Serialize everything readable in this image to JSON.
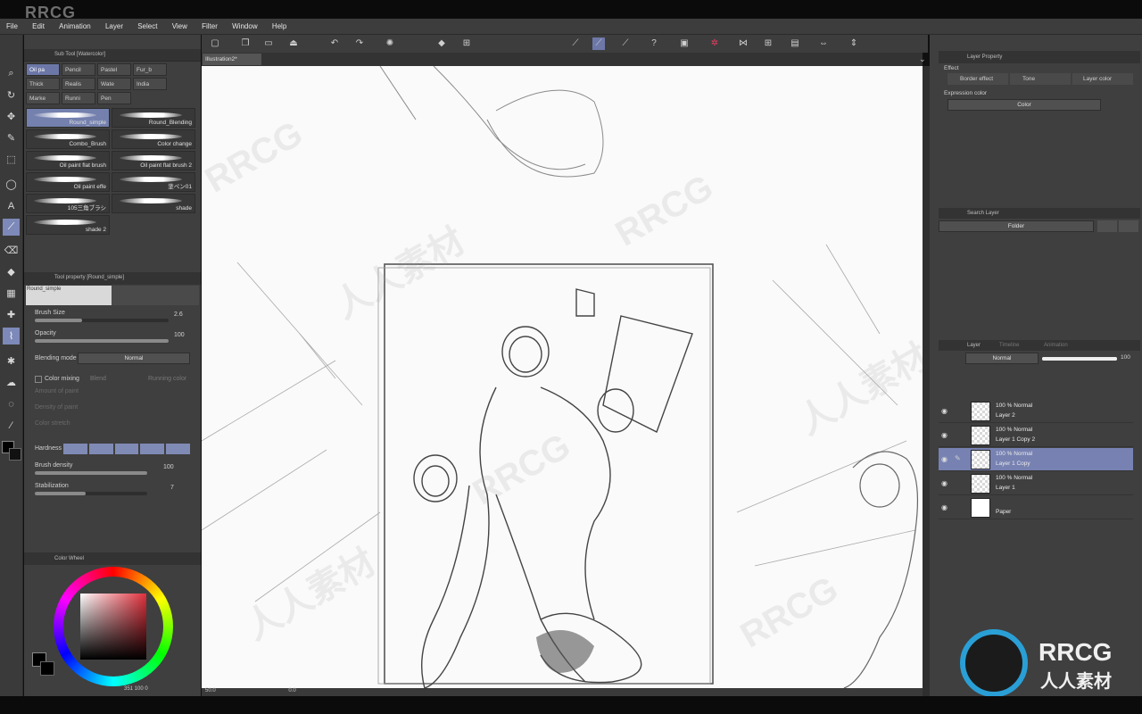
{
  "menu": [
    "File",
    "Edit",
    "Animation",
    "Layer",
    "Select",
    "View",
    "Filter",
    "Window",
    "Help"
  ],
  "watermark_logo": "RRCG",
  "watermark_text": "人人素材",
  "subtool": {
    "title": "Sub Tool [Watercolor]",
    "tabs": [
      "Oil pa",
      "Pencil",
      "Pastel",
      "Fur_b",
      "Thick",
      "Realis",
      "Wate",
      "India",
      "Marke",
      "Runni",
      "Pen"
    ],
    "brushes": [
      "Round_simple",
      "Round_Blending",
      "Combo_Brush",
      "Color change",
      "Oil paint flat brush",
      "Oil paint flat brush 2",
      "Oil paint effe",
      "塗ペン01",
      "105三角ブラシ",
      "shade",
      "shade 2"
    ]
  },
  "toolprop": {
    "title": "Tool property [Round_simple]",
    "preview_name": "Round_simple",
    "brush_size_label": "Brush Size",
    "brush_size": "2.6",
    "opacity_label": "Opacity",
    "opacity": "100",
    "blending_label": "Blending mode",
    "blending": "Normal",
    "color_mixing": "Color mixing",
    "blend": "Blend",
    "running_color": "Running color",
    "amount_of_paint": "Amount of paint",
    "density_of_paint": "Density of paint",
    "color_stretch": "Color stretch",
    "hardness_label": "Hardness",
    "brush_density_label": "Brush density",
    "brush_density": "100",
    "stabilization_label": "Stabilization",
    "stabilization": "7"
  },
  "colorwheel": {
    "title": "Color Wheel",
    "readout": "351 100 0"
  },
  "document": {
    "tab": "Illustration2*",
    "zoom": "50.0",
    "rotation": "0.0"
  },
  "layer_property": {
    "title": "Layer Property",
    "effect_label": "Effect",
    "border_effect": "Border effect",
    "tone": "Tone",
    "layer_color": "Layer color",
    "expression_label": "Expression color",
    "expression_value": "Color"
  },
  "search_layer": {
    "title": "Search Layer",
    "folder": "Folder"
  },
  "layers_panel": {
    "tabs": [
      "Layer",
      "Timeline",
      "Animation"
    ],
    "blend_mode": "Normal",
    "opacity": "100",
    "rows": [
      {
        "mode": "100 % Normal",
        "name": "Layer 2",
        "active": false
      },
      {
        "mode": "100 % Normal",
        "name": "Layer 1 Copy 2",
        "active": false
      },
      {
        "mode": "100 % Normal",
        "name": "Layer 1 Copy",
        "active": true
      },
      {
        "mode": "100 % Normal",
        "name": "Layer 1",
        "active": false
      },
      {
        "mode": "",
        "name": "Paper",
        "active": false
      }
    ]
  },
  "colors": {
    "accent": "#7782b2",
    "panel": "#3f3f3f",
    "canvas": "#fafafa"
  }
}
